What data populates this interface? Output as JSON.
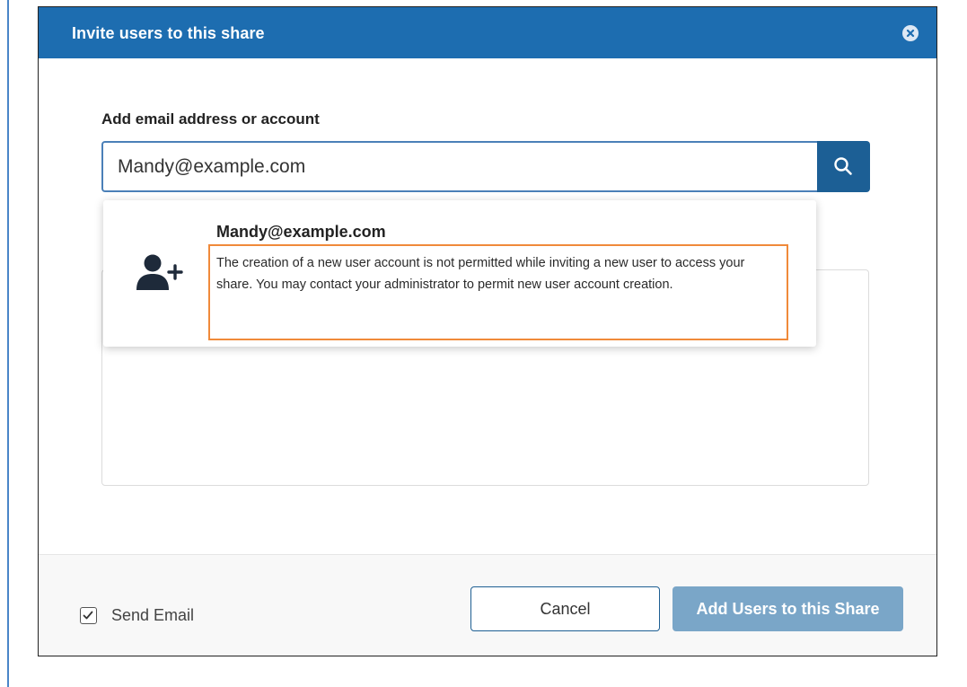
{
  "dialog": {
    "title": "Invite users to this share",
    "close_icon": "close-circle-icon"
  },
  "form": {
    "label": "Add email address or account",
    "input_value": "Mandy@example.com",
    "search_icon": "search-icon"
  },
  "suggestion": {
    "icon": "add-user-icon",
    "email": "Mandy@example.com",
    "warning": "The creation of a new user account is not permitted while inviting a new user to access your share. You may contact your administrator to permit new user account creation."
  },
  "footer": {
    "send_email_label": "Send Email",
    "send_email_checked": true,
    "cancel_label": "Cancel",
    "add_label": "Add Users to this Share"
  },
  "colors": {
    "header": "#1d6db0",
    "search_button": "#1c5f95",
    "highlight": "#f08a3a",
    "primary_disabled": "#7aa6c8"
  }
}
